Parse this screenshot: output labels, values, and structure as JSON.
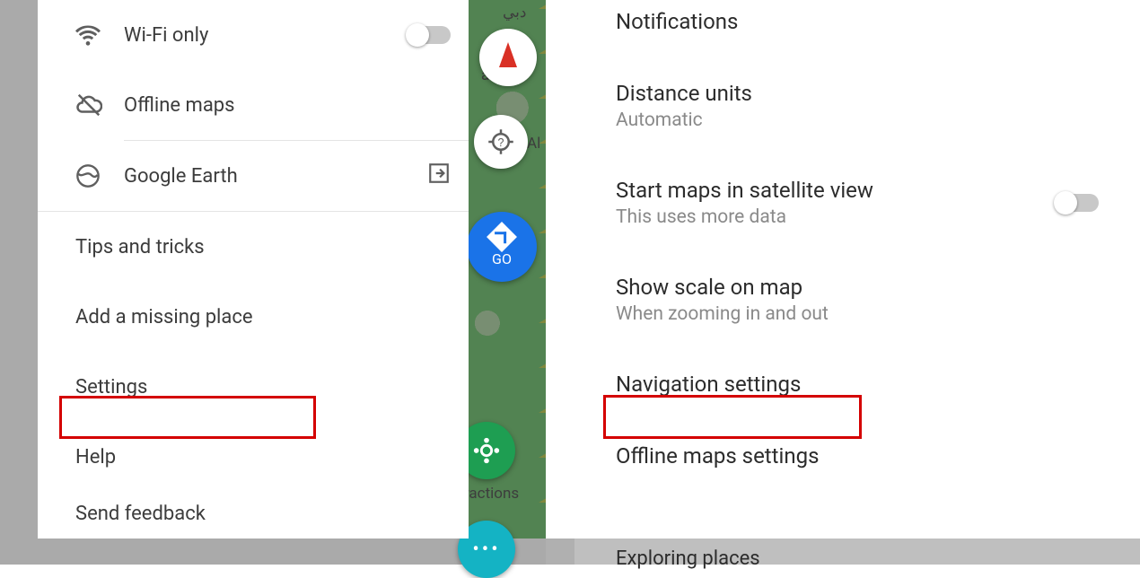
{
  "left": {
    "items": [
      {
        "label": "Wi-Fi only",
        "icon": "wifi-icon",
        "has_toggle": true
      },
      {
        "label": "Offline maps",
        "icon": "cloud-off-icon"
      }
    ],
    "earth": {
      "label": "Google Earth",
      "icon": "earth-icon",
      "launch_icon": "open-in-icon"
    },
    "plain": [
      "Tips and tricks",
      "Add a missing place",
      "Settings",
      "Help",
      "Send feedback"
    ],
    "map_labels": {
      "dubai": "دبي",
      "ab": "ab",
      "al": "Al",
      "ractions": "ractions"
    },
    "go_label": "GO"
  },
  "right": {
    "items": [
      {
        "title": "Notifications"
      },
      {
        "title": "Distance units",
        "sub": "Automatic"
      },
      {
        "title": "Start maps in satellite view",
        "sub": "This uses more data",
        "toggle": true
      },
      {
        "title": "Show scale on map",
        "sub": "When zooming in and out"
      },
      {
        "title": "Navigation settings",
        "highlight": true
      },
      {
        "title": "Offline maps settings"
      }
    ],
    "partial_next": "Exploring places"
  }
}
